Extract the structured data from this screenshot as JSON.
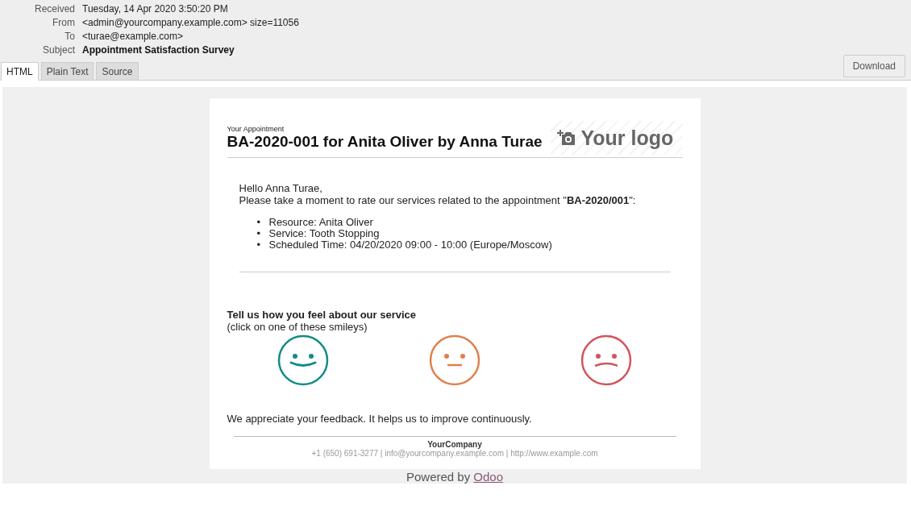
{
  "headers": [
    {
      "label": "Received",
      "value": "Tuesday, 14 Apr 2020 3:50:20 PM",
      "bold": false
    },
    {
      "label": "From",
      "value": "<admin@yourcompany.example.com> size=11056",
      "bold": false
    },
    {
      "label": "To",
      "value": "<turae@example.com>",
      "bold": false
    },
    {
      "label": "Subject",
      "value": "Appointment Satisfaction Survey",
      "bold": true
    }
  ],
  "tabs": [
    {
      "label": "HTML",
      "selected": true
    },
    {
      "label": "Plain Text",
      "selected": false
    },
    {
      "label": "Source",
      "selected": false
    }
  ],
  "download_button": "Download",
  "email": {
    "kicker": "Your Appointment",
    "title": "BA-2020-001 for Anita Oliver by Anna Turae",
    "logo_text": "Your logo",
    "greeting": "Hello Anna Turae,",
    "intro": "Please take a moment to rate our services related to the appointment \"**BA-2020/001**\":",
    "bullet": "•",
    "details": [
      "Resource: Anita Oliver",
      "Service: Tooth Stopping",
      "Scheduled Time: 04/20/2020 09:00 - 10:00 (Europe/Moscow)"
    ],
    "prompt": "Tell us how you feel about our service",
    "prompt_hint": "(click on one of these smileys)",
    "smileys": [
      {
        "kind": "happy",
        "color": "#138b88"
      },
      {
        "kind": "neutral",
        "color": "#e0804f"
      },
      {
        "kind": "sad",
        "color": "#d0565c"
      }
    ],
    "thanks": "We appreciate your feedback. It helps us to improve continuously.",
    "company": "YourCompany",
    "contact": "+1 (650) 691-3277 | info@yourcompany.example.com | http://www.example.com"
  },
  "powered_by": {
    "text": "Powered by",
    "link": "Odoo"
  }
}
